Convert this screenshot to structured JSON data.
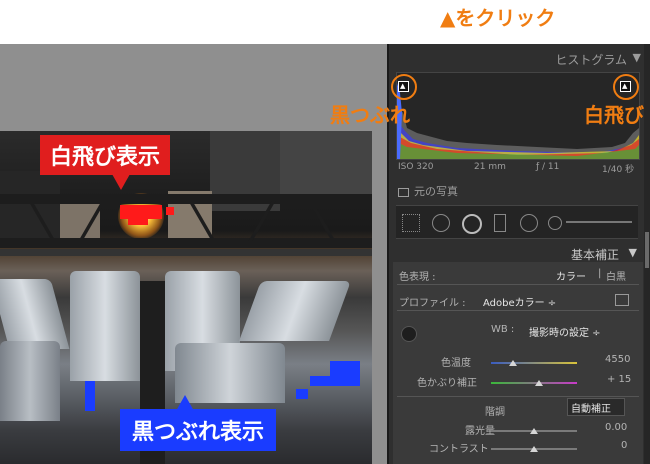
{
  "callouts": {
    "top": "▲をクリック",
    "shadows_clip": "黒つぶれ",
    "highlights_clip": "白飛び",
    "photo_highlights": "白飛び表示",
    "photo_shadows": "黒つぶれ表示"
  },
  "histogram": {
    "title": "ヒストグラム",
    "collapse_icon": "triangle-down-icon",
    "iso": "ISO 320",
    "focal": "21 mm",
    "aperture": "ƒ / 11",
    "shutter": "1/40 秒",
    "original_photo": "元の写真"
  },
  "basic": {
    "title": "基本補正",
    "treatment_label": "色表現 :",
    "treatment_color": "カラー",
    "treatment_sep": "|",
    "treatment_bw": "白黒",
    "profile_label": "プロファイル :",
    "profile_value": "Adobeカラー ÷",
    "wb_label": "WB :",
    "wb_value": "撮影時の設定 ÷",
    "temp_label": "色温度",
    "temp_value": "4550",
    "tint_label": "色かぶり補正",
    "tint_value": "+ 15",
    "tone_label": "階調",
    "auto_label": "自動補正",
    "exposure_label": "露光量",
    "exposure_value": "0.00",
    "contrast_label": "コントラスト",
    "contrast_value": "0"
  },
  "colors": {
    "accent_orange": "#f07d12",
    "highlight_red": "#e01e1e",
    "shadow_blue": "#1a3cff",
    "panel_bg": "#2f2f2f"
  }
}
